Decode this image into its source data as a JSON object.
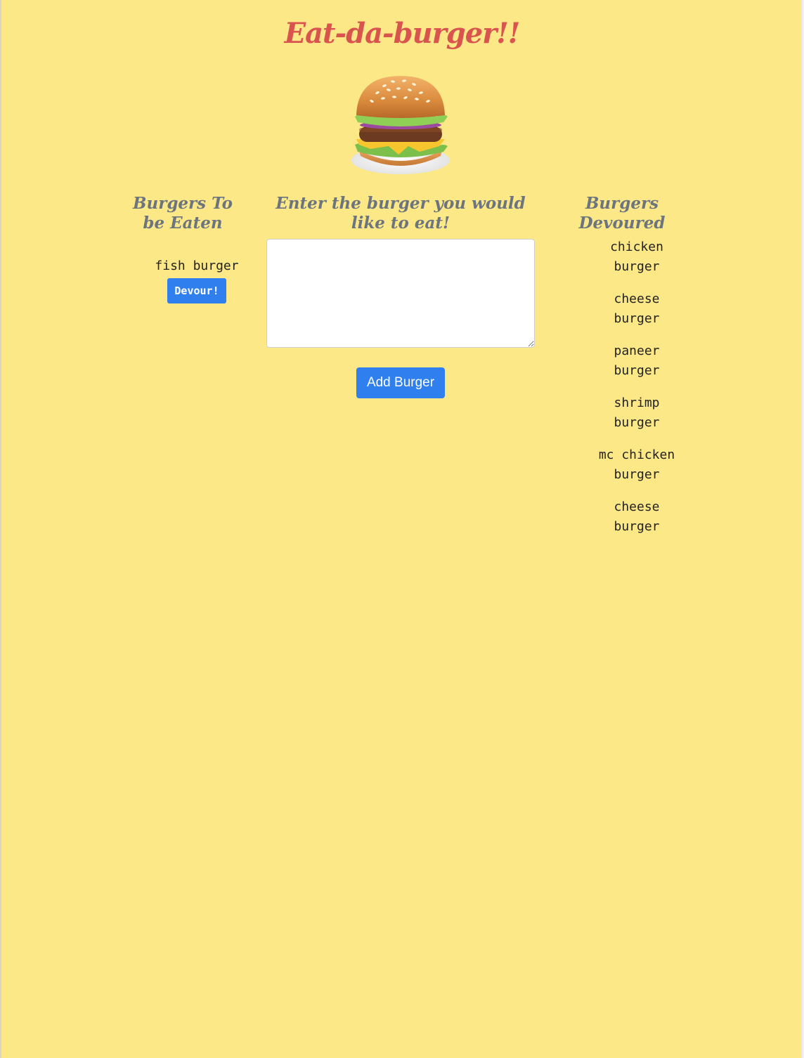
{
  "title": "Eat-da-burger!!",
  "colors": {
    "background": "#fde887",
    "title": "#d9534f",
    "heading": "#6c757d",
    "button": "#2f7fef"
  },
  "hero_icon": "burger-icon",
  "columns": {
    "to_eat": {
      "heading": "Burgers To be Eaten",
      "items": [
        {
          "name": "fish burger",
          "button_label": "Devour!"
        }
      ]
    },
    "add": {
      "heading": "Enter the burger you would like to eat!",
      "input_value": "",
      "button_label": "Add Burger"
    },
    "devoured": {
      "heading": "Burgers Devoured",
      "items": [
        {
          "line1": "chicken",
          "line2": "burger"
        },
        {
          "line1": "cheese",
          "line2": "burger"
        },
        {
          "line1": "paneer",
          "line2": "burger"
        },
        {
          "line1": "shrimp",
          "line2": "burger"
        },
        {
          "line1": "mc chicken",
          "line2": "burger"
        },
        {
          "line1": "cheese",
          "line2": "burger"
        }
      ]
    }
  }
}
